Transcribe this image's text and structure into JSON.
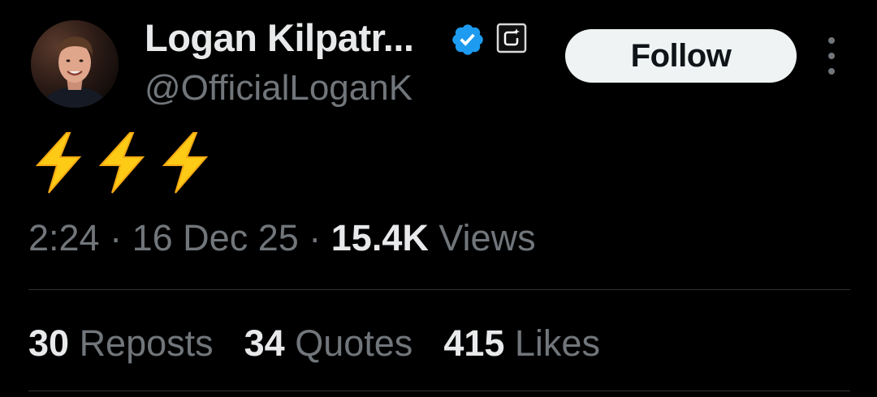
{
  "author": {
    "display_name": "Logan Kilpatr...",
    "handle": "@OfficialLoganK",
    "verified_color": "#1d9bf0"
  },
  "actions": {
    "follow_label": "Follow",
    "more_icon": "more-vertical-icon"
  },
  "tweet": {
    "text": "⚡⚡⚡",
    "bolt_color": "#fdcb16"
  },
  "meta": {
    "time": "2:24",
    "separator": "·",
    "date": "16 Dec 25",
    "views_count": "15.4K",
    "views_label": "Views"
  },
  "stats": [
    {
      "count": "30",
      "label": "Reposts"
    },
    {
      "count": "34",
      "label": "Quotes"
    },
    {
      "count": "415",
      "label": "Likes"
    }
  ],
  "colors": {
    "background": "#000000",
    "primary_text": "#e7e9ea",
    "secondary_text": "#71767b",
    "divider": "#2f3336"
  }
}
